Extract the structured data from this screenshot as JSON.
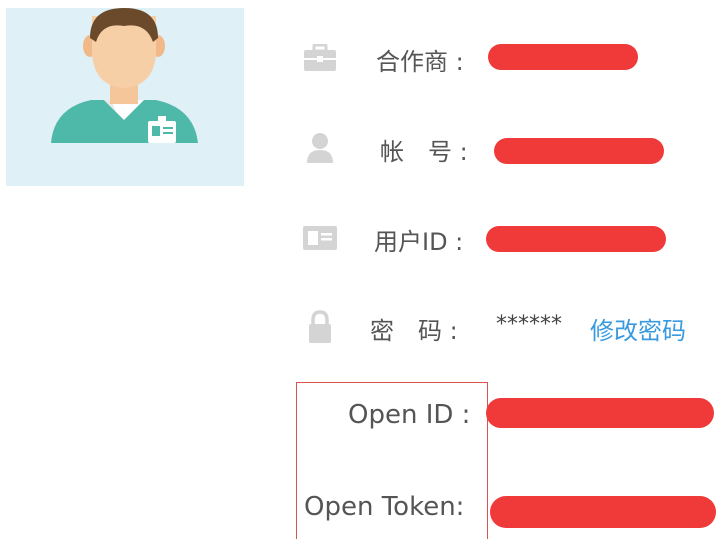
{
  "profile": {
    "partner_label": "合作商 :",
    "account_label": "帐　号 :",
    "user_id_label": "用户ID :",
    "password_label": "密　码 :",
    "password_value": "******",
    "change_password_link": "修改密码",
    "open_id_label": "Open ID :",
    "open_token_label": "Open Token:"
  },
  "icons": {
    "partner": "briefcase-icon",
    "account": "user-icon",
    "user_id": "id-card-icon",
    "password": "lock-icon"
  },
  "colors": {
    "avatar_bg": "#dff0f7",
    "redaction": "#f03a3a",
    "link": "#3a9ae0",
    "highlight_border": "#d9534f"
  }
}
